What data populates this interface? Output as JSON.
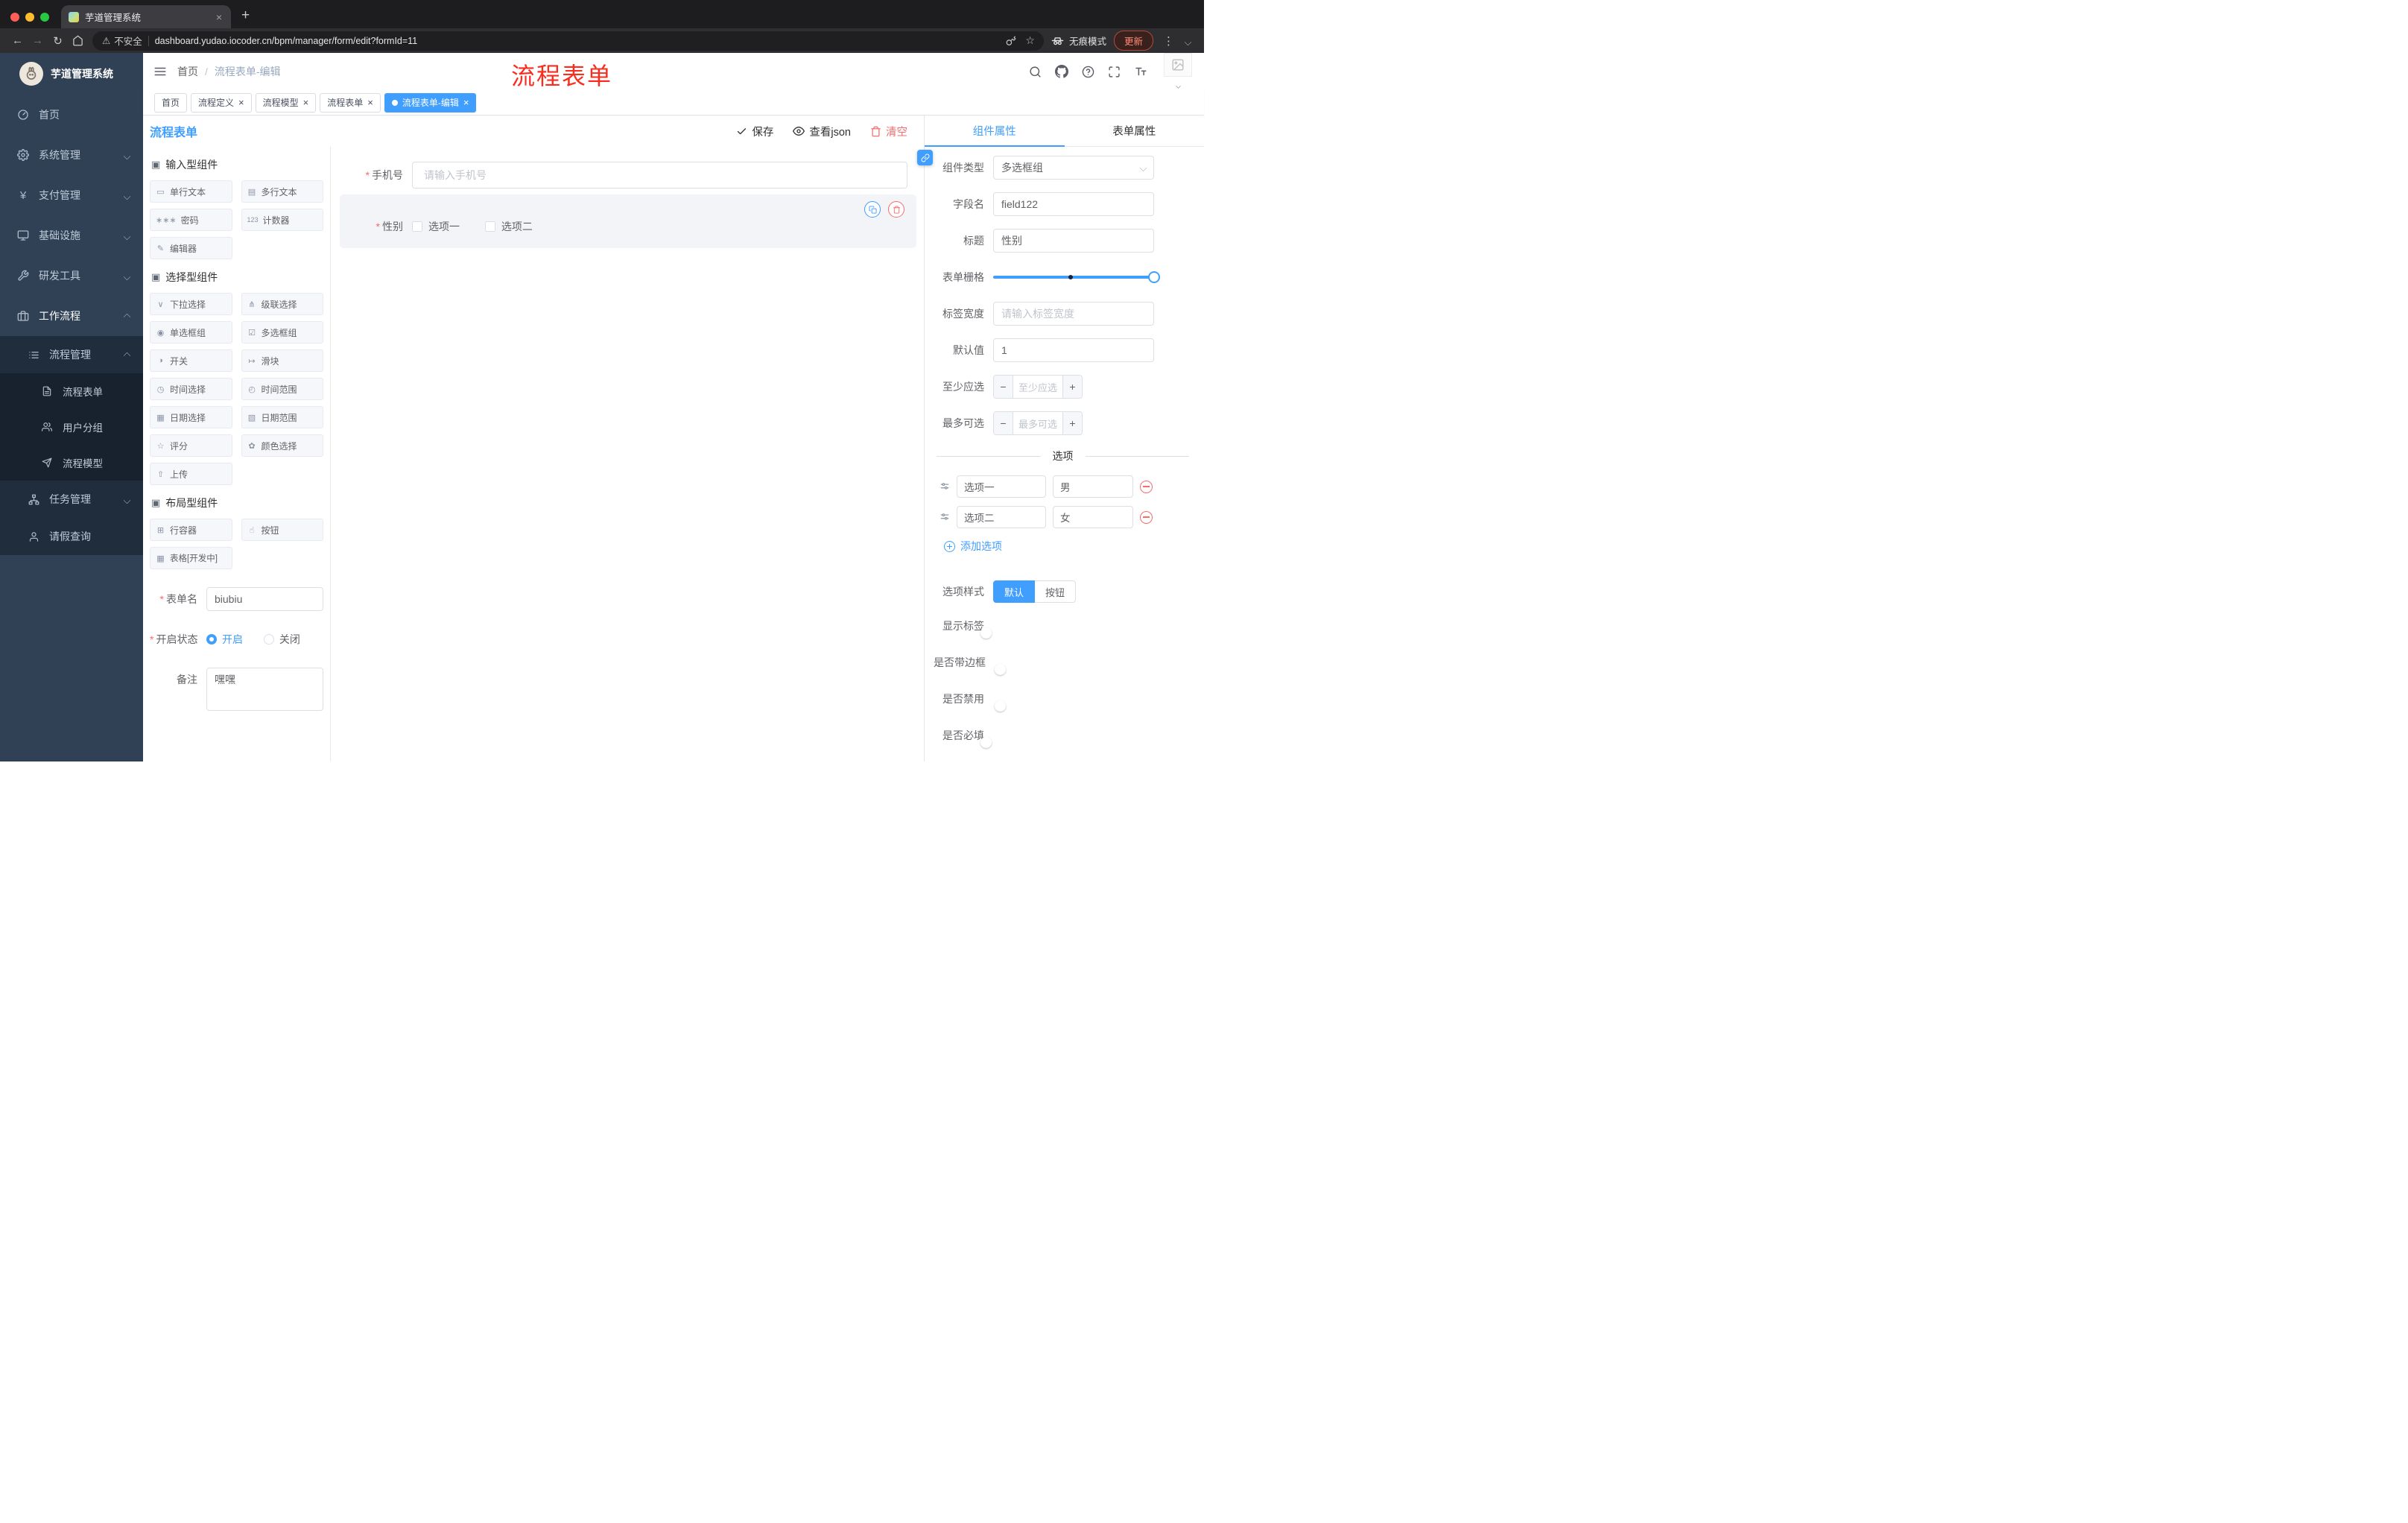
{
  "colors": {
    "accent": "#409eff",
    "danger": "#f56c6c",
    "sidebar_bg": "#304156",
    "annotation_red": "#fa2c1e",
    "tag_active": "#409eff"
  },
  "misc": {
    "asterisk": "*",
    "close": "×",
    "minus": "−",
    "plus": "+"
  },
  "browser": {
    "tab": {
      "title": "芋道管理系统"
    },
    "new_tab": "+",
    "nav": {
      "back": "←",
      "forward": "→",
      "reload": "↻"
    },
    "address": {
      "warning_glyph": "⚠",
      "warning": "不安全",
      "url": "dashboard.yudao.iocoder.cn/bpm/manager/form/edit?formId=11"
    },
    "bookmark_glyph": "☆",
    "incognito": "无痕模式",
    "update": "更新",
    "menu": "⋮"
  },
  "sidebar": {
    "title": "芋道管理系统",
    "items": [
      {
        "label": "首页"
      },
      {
        "label": "系统管理"
      },
      {
        "label": "支付管理"
      },
      {
        "label": "基础设施"
      },
      {
        "label": "研发工具"
      },
      {
        "label": "工作流程"
      }
    ],
    "workflow": {
      "process_mgmt": {
        "label": "流程管理",
        "children": [
          {
            "label": "流程表单"
          },
          {
            "label": "用户分组"
          },
          {
            "label": "流程模型"
          }
        ]
      },
      "task_mgmt": {
        "label": "任务管理"
      },
      "leave_query": {
        "label": "请假查询"
      }
    }
  },
  "header": {
    "breadcrumb": {
      "first": "首页",
      "separator": "/",
      "current": "流程表单-编辑"
    },
    "annotation": "流程表单"
  },
  "tags": [
    {
      "label": "首页",
      "closable": false,
      "active": false
    },
    {
      "label": "流程定义",
      "closable": true,
      "active": false
    },
    {
      "label": "流程模型",
      "closable": true,
      "active": false
    },
    {
      "label": "流程表单",
      "closable": true,
      "active": false
    },
    {
      "label": "流程表单-编辑",
      "closable": true,
      "active": true
    }
  ],
  "workspace": {
    "title": "流程表单",
    "actions": {
      "save": "保存",
      "view_json": "查看json",
      "clear": "清空"
    }
  },
  "palette": {
    "section_glyph": "▣",
    "sections": [
      {
        "title": "输入型组件",
        "items": [
          {
            "label": "单行文本",
            "glyph": "▭"
          },
          {
            "label": "多行文本",
            "glyph": "▤"
          },
          {
            "label": "密码",
            "glyph": "∗∗∗"
          },
          {
            "label": "计数器",
            "glyph": "123"
          },
          {
            "label": "编辑器",
            "glyph": "✎"
          }
        ]
      },
      {
        "title": "选择型组件",
        "items": [
          {
            "label": "下拉选择",
            "glyph": "∨"
          },
          {
            "label": "级联选择",
            "glyph": "⋔"
          },
          {
            "label": "单选框组",
            "glyph": "◉"
          },
          {
            "label": "多选框组",
            "glyph": "☑"
          },
          {
            "label": "开关",
            "glyph": "◑"
          },
          {
            "label": "滑块",
            "glyph": "↦"
          },
          {
            "label": "时间选择",
            "glyph": "◷"
          },
          {
            "label": "时间范围",
            "glyph": "◴"
          },
          {
            "label": "日期选择",
            "glyph": "▦"
          },
          {
            "label": "日期范围",
            "glyph": "▧"
          },
          {
            "label": "评分",
            "glyph": "☆"
          },
          {
            "label": "颜色选择",
            "glyph": "✿"
          },
          {
            "label": "上传",
            "glyph": "⇧"
          }
        ]
      },
      {
        "title": "布局型组件",
        "items": [
          {
            "label": "行容器",
            "glyph": "⊞"
          },
          {
            "label": "按钮",
            "glyph": "☝"
          },
          {
            "label": "表格[开发中]",
            "glyph": "▦"
          }
        ]
      }
    ]
  },
  "form_meta": {
    "name": {
      "label": "表单名",
      "value": "biubiu",
      "required": true
    },
    "status": {
      "label": "开启状态",
      "required": true,
      "options": [
        {
          "label": "开启",
          "selected": true
        },
        {
          "label": "关闭",
          "selected": false
        }
      ]
    },
    "remark": {
      "label": "备注",
      "value": "嘿嘿"
    }
  },
  "canvas": {
    "phone": {
      "label": "手机号",
      "required": true,
      "placeholder": "请输入手机号"
    },
    "gender": {
      "label": "性别",
      "required": true,
      "selected": true,
      "options": [
        {
          "label": "选项一",
          "checked": false
        },
        {
          "label": "选项二",
          "checked": false
        }
      ]
    }
  },
  "props": {
    "tabs": {
      "component": "组件属性",
      "form": "表单属性"
    },
    "component_type": {
      "label": "组件类型",
      "value": "多选框组"
    },
    "field_name": {
      "label": "字段名",
      "value": "field122"
    },
    "title": {
      "label": "标题",
      "value": "性别"
    },
    "grid": {
      "label": "表单栅格",
      "value": 24
    },
    "label_width": {
      "label": "标签宽度",
      "placeholder": "请输入标签宽度"
    },
    "default_value": {
      "label": "默认值",
      "value": "1"
    },
    "min_count": {
      "label": "至少应选",
      "placeholder": "至少应选"
    },
    "max_count": {
      "label": "最多可选",
      "placeholder": "最多可选"
    },
    "options_title": "选项",
    "options": [
      {
        "label": "选项一",
        "value": "男"
      },
      {
        "label": "选项二",
        "value": "女"
      }
    ],
    "add_option": "添加选项",
    "option_style": {
      "label": "选项样式",
      "options": [
        {
          "label": "默认",
          "selected": true
        },
        {
          "label": "按钮",
          "selected": false
        }
      ]
    },
    "switches": [
      {
        "label": "显示标签",
        "on": true
      },
      {
        "label": "是否带边框",
        "on": false
      },
      {
        "label": "是否禁用",
        "on": false
      },
      {
        "label": "是否必填",
        "on": true
      }
    ]
  }
}
